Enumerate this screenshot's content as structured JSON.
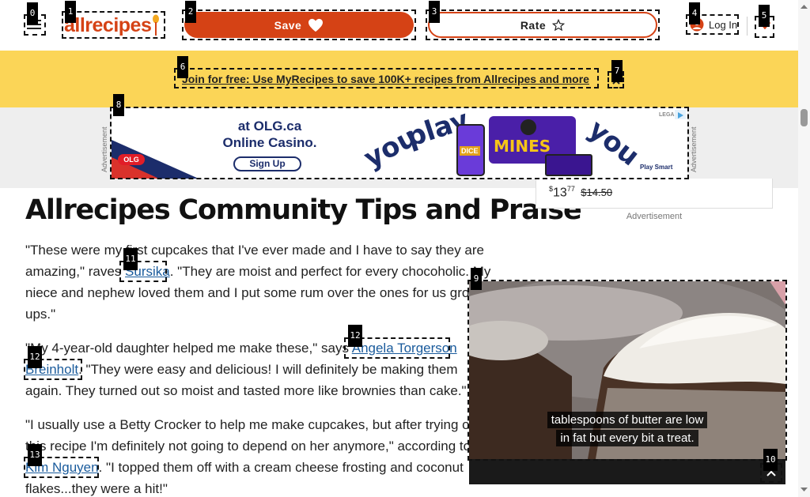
{
  "header": {
    "logo_text": "allrecipes",
    "save_label": "Save",
    "rate_label": "Rate",
    "login_label": "Log In",
    "icons": {
      "menu": "hamburger-menu-icon",
      "save": "heart-icon",
      "rate": "star-icon",
      "login": "user-icon",
      "jump": "chevron-down-icon"
    }
  },
  "banner": {
    "text": "Join for free: Use MyRecipes to save 100K+ recipes from Allrecipes and more"
  },
  "ad": {
    "side_label": "Advertisement",
    "brand": "OLG",
    "headline_line1": "at OLG.ca",
    "headline_line2": "Online Casino.",
    "cta": "Sign Up",
    "word1": "you",
    "word2": "play",
    "word3": "you",
    "game1": "DICE",
    "game2": "MINES",
    "legal": "LEGAL",
    "play_smart": "Play Smart"
  },
  "article": {
    "title": "Allrecipes Community Tips and Praise",
    "p1_before": "\"These were my first cupcakes that I've ever made and I have to say they are amazing,\" raves ",
    "p1_author": "Sursika",
    "p1_after": ". \"They are moist and perfect for every chocoholic. My niece and nephew loved them and I put some rum over the ones for us grown-ups.\"",
    "p2_before": "\"My 4-year-old daughter helped me make these,\" says ",
    "p2_author": "Angela Torgerson Breinholt",
    "p2_after": ". \"They were easy and delicious! I will definitely be making them again. They turned out so moist and tasted more like brownies than cake.\"",
    "p3_before": "\"I usually use a Betty Crocker to help me make cupcakes, but after trying out this recipe I'm definitely not going to depend on her anymore,\" according to ",
    "p3_author": "Kim Nguyen",
    "p3_after": ". \"I topped them off with a cream cheese frosting and coconut flakes...they were a hit!\""
  },
  "sidebar": {
    "price_currency": "$",
    "price_whole": "13",
    "price_cents": "77",
    "price_old": "$14.50",
    "ad_label": "Advertisement"
  },
  "video": {
    "caption_line1": "tablespoons of butter are low",
    "caption_line2": "in fat but every bit a treat."
  },
  "markers": [
    "0",
    "1",
    "2",
    "3",
    "4",
    "5",
    "6",
    "7",
    "8",
    "9",
    "10",
    "11",
    "12",
    "12",
    "13"
  ],
  "colors": {
    "brand": "#d54215",
    "banner": "#fbd557",
    "link": "#1a5b9c"
  }
}
